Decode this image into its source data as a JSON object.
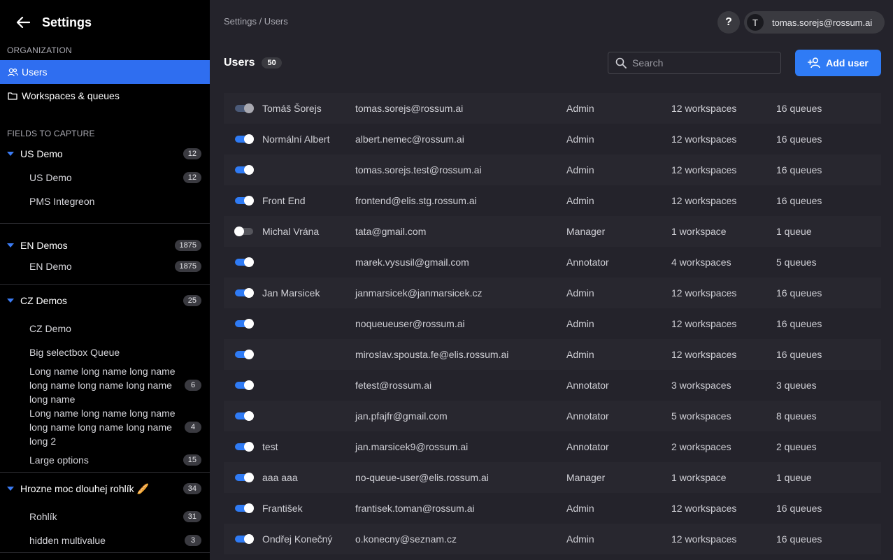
{
  "sidebar": {
    "title": "Settings",
    "organization_label": "ORGANIZATION",
    "nav": [
      {
        "label": "Users",
        "icon": "users-icon"
      },
      {
        "label": "Workspaces & queues",
        "icon": "folder-icon"
      }
    ],
    "fields_label": "FIELDS TO CAPTURE",
    "groups": [
      {
        "name": "US Demo",
        "count": "12",
        "queues": [
          {
            "name": "US Demo",
            "count": "12"
          },
          {
            "name": "PMS Integreon",
            "count": ""
          }
        ]
      },
      {
        "name": "EN Demos",
        "count": "1875",
        "queues": [
          {
            "name": "EN Demo",
            "count": "1875"
          }
        ]
      },
      {
        "name": "CZ Demos",
        "count": "25",
        "queues": [
          {
            "name": "CZ Demo",
            "count": ""
          },
          {
            "name": "Big selectbox Queue",
            "count": ""
          },
          {
            "name": "Long name long name long name long name long name long name long name",
            "count": "6"
          },
          {
            "name": "Long name long name long name long name long name long name long 2",
            "count": "4"
          },
          {
            "name": "Large options",
            "count": "15"
          }
        ]
      },
      {
        "name": "Hrozne moc dlouhej rohlík 🥖",
        "count": "34",
        "queues": [
          {
            "name": "Rohlík",
            "count": "31"
          },
          {
            "name": "hidden multivalue",
            "count": "3"
          }
        ]
      }
    ]
  },
  "header": {
    "breadcrumb": "Settings / Users",
    "help_label": "?",
    "user_initial": "T",
    "user_email": "tomas.sorejs@rossum.ai"
  },
  "main": {
    "title": "Users",
    "count": "50",
    "search_placeholder": "Search",
    "add_label": "Add user"
  },
  "users": [
    {
      "name": "Tomáš Šorejs",
      "email": "tomas.sorejs@rossum.ai",
      "role": "Admin",
      "workspaces": "12 workspaces",
      "queues": "16 queues",
      "toggle": "dim"
    },
    {
      "name": "Normální Albert",
      "email": "albert.nemec@rossum.ai",
      "role": "Admin",
      "workspaces": "12 workspaces",
      "queues": "16 queues",
      "toggle": "on"
    },
    {
      "name": "",
      "email": "tomas.sorejs.test@rossum.ai",
      "role": "Admin",
      "workspaces": "12 workspaces",
      "queues": "16 queues",
      "toggle": "on"
    },
    {
      "name": "Front End",
      "email": "frontend@elis.stg.rossum.ai",
      "role": "Admin",
      "workspaces": "12 workspaces",
      "queues": "16 queues",
      "toggle": "on"
    },
    {
      "name": "Michal Vrána",
      "email": "tata@gmail.com",
      "role": "Manager",
      "workspaces": "1 workspace",
      "queues": "1 queue",
      "toggle": "off"
    },
    {
      "name": "",
      "email": "marek.vysusil@gmail.com",
      "role": "Annotator",
      "workspaces": "4 workspaces",
      "queues": "5 queues",
      "toggle": "on"
    },
    {
      "name": "Jan Marsicek",
      "email": "janmarsicek@janmarsicek.cz",
      "role": "Admin",
      "workspaces": "12 workspaces",
      "queues": "16 queues",
      "toggle": "on"
    },
    {
      "name": "",
      "email": "noqueueuser@rossum.ai",
      "role": "Admin",
      "workspaces": "12 workspaces",
      "queues": "16 queues",
      "toggle": "on"
    },
    {
      "name": "",
      "email": "miroslav.spousta.fe@elis.rossum.ai",
      "role": "Admin",
      "workspaces": "12 workspaces",
      "queues": "16 queues",
      "toggle": "on"
    },
    {
      "name": "",
      "email": "fetest@rossum.ai",
      "role": "Annotator",
      "workspaces": "3 workspaces",
      "queues": "3 queues",
      "toggle": "on"
    },
    {
      "name": "",
      "email": "jan.pfajfr@gmail.com",
      "role": "Annotator",
      "workspaces": "5 workspaces",
      "queues": "8 queues",
      "toggle": "on"
    },
    {
      "name": "test",
      "email": "jan.marsicek9@rossum.ai",
      "role": "Annotator",
      "workspaces": "2 workspaces",
      "queues": "2 queues",
      "toggle": "on"
    },
    {
      "name": "aaa aaa",
      "email": "no-queue-user@elis.rossum.ai",
      "role": "Manager",
      "workspaces": "1 workspace",
      "queues": "1 queue",
      "toggle": "on"
    },
    {
      "name": "František",
      "email": "frantisek.toman@rossum.ai",
      "role": "Admin",
      "workspaces": "12 workspaces",
      "queues": "16 queues",
      "toggle": "on"
    },
    {
      "name": "Ondřej Konečný",
      "email": "o.konecny@seznam.cz",
      "role": "Admin",
      "workspaces": "12 workspaces",
      "queues": "16 queues",
      "toggle": "on"
    }
  ]
}
